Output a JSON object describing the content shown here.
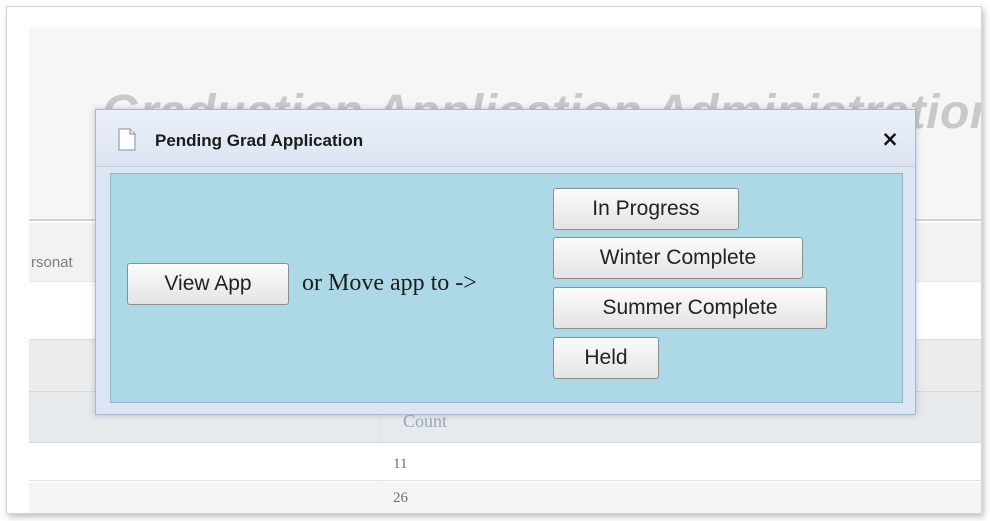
{
  "background": {
    "page_title": "Graduation Application Administration",
    "nav_text": "rsonat",
    "table": {
      "column_header": "Count",
      "rows": [
        "11",
        "26"
      ]
    }
  },
  "dialog": {
    "title": "Pending Grad Application",
    "close_label": "×",
    "view_button": "View App",
    "move_text": "or Move app to ->",
    "targets": [
      "In Progress",
      "Winter Complete",
      "Summer Complete",
      "Held"
    ]
  },
  "icons": {
    "title_icon": "document-icon",
    "close_icon": "close-icon"
  },
  "colors": {
    "dialog_body": "#add8e6",
    "dialog_frame": "#dce6f3",
    "title_text": "#1b1b1b"
  }
}
